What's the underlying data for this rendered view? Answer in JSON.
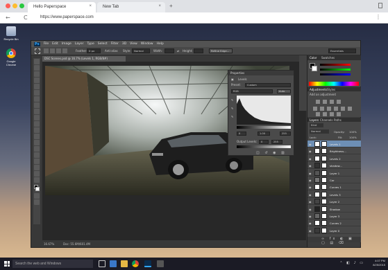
{
  "browser": {
    "active_tab": "Hello Paperspace",
    "inactive_tab": "New Tab",
    "tab_close": "×",
    "new_tab": "+",
    "url": "https://www.paperspace.com",
    "back": "←",
    "refresh": "C",
    "menu": "⋮"
  },
  "desktop": {
    "icons": [
      {
        "label": "Recycle Bin",
        "icon": "recycle-bin-icon"
      },
      {
        "label": "Google Chrome",
        "icon": "chrome-icon"
      }
    ]
  },
  "photoshop": {
    "app_logo": "Ps",
    "menus": [
      "File",
      "Edit",
      "Image",
      "Layer",
      "Type",
      "Select",
      "Filter",
      "3D",
      "View",
      "Window",
      "Help"
    ],
    "options_bar": {
      "feather_label": "Feather:",
      "feather_value": "0 px",
      "antialias": "Anti-alias",
      "style_label": "Style:",
      "style_value": "Normal",
      "width_label": "Width:",
      "height_label": "Height:",
      "refine": "Refine Edge...",
      "workspace": "Essentials"
    },
    "document_tab": "DSC Scenes.psd @ 16.7% (Levels 1, RGB/8#)",
    "status": {
      "zoom": "16.67%",
      "doc_info": "Doc: 55.6M/601.4M"
    },
    "properties": {
      "title": "Properties",
      "subtitle": "Levels",
      "preset_label": "Preset:",
      "preset_value": "Custom",
      "channel_value": "RGB",
      "auto": "Auto",
      "input_black": "0",
      "input_mid": "1.00",
      "input_white": "255",
      "output_label": "Output Levels:",
      "output_black": "0",
      "output_white": "255"
    },
    "color_panel": {
      "tabs": [
        "Color",
        "Swatches"
      ]
    },
    "adjustments": {
      "tabs": [
        "Adjustments",
        "Styles"
      ],
      "hint": "Add an adjustment"
    },
    "layers": {
      "tabs": [
        "Layers",
        "Channels",
        "Paths"
      ],
      "kind": "Kind",
      "blend_mode": "Normal",
      "opacity_label": "Opacity:",
      "opacity_value": "100%",
      "lock_label": "Lock:",
      "fill_label": "Fill:",
      "fill_value": "100%",
      "items": [
        {
          "name": "Levels 1",
          "selected": true,
          "thumb": "#ffffff"
        },
        {
          "name": "Brightness...",
          "selected": false,
          "thumb": "#ffffff"
        },
        {
          "name": "Levels 2",
          "selected": false,
          "thumb": "#ffffff"
        },
        {
          "name": "shadow...",
          "selected": false,
          "thumb": "#333333"
        },
        {
          "name": "Layer 1",
          "selected": false,
          "thumb": "#555555"
        },
        {
          "name": "Car",
          "selected": false,
          "thumb": "#777777"
        },
        {
          "name": "Curves 1",
          "selected": false,
          "thumb": "#ffffff"
        },
        {
          "name": "Levels 3",
          "selected": false,
          "thumb": "#ffffff"
        },
        {
          "name": "Layer 2",
          "selected": false,
          "thumb": "#444444"
        },
        {
          "name": "Shadow",
          "selected": false,
          "thumb": "#222222"
        },
        {
          "name": "Layer 3",
          "selected": false,
          "thumb": "#666666"
        },
        {
          "name": "Curves 2",
          "selected": false,
          "thumb": "#ffffff"
        },
        {
          "name": "Layer 0",
          "selected": false,
          "thumb": "#3a3a3a"
        }
      ]
    }
  },
  "taskbar": {
    "search_placeholder": "Search the web and Windows",
    "time": "4:07 PM",
    "date": "8/25/2015"
  },
  "colors": {
    "ps_blue": "#31a8ff",
    "selection": "#6d8fb5"
  }
}
